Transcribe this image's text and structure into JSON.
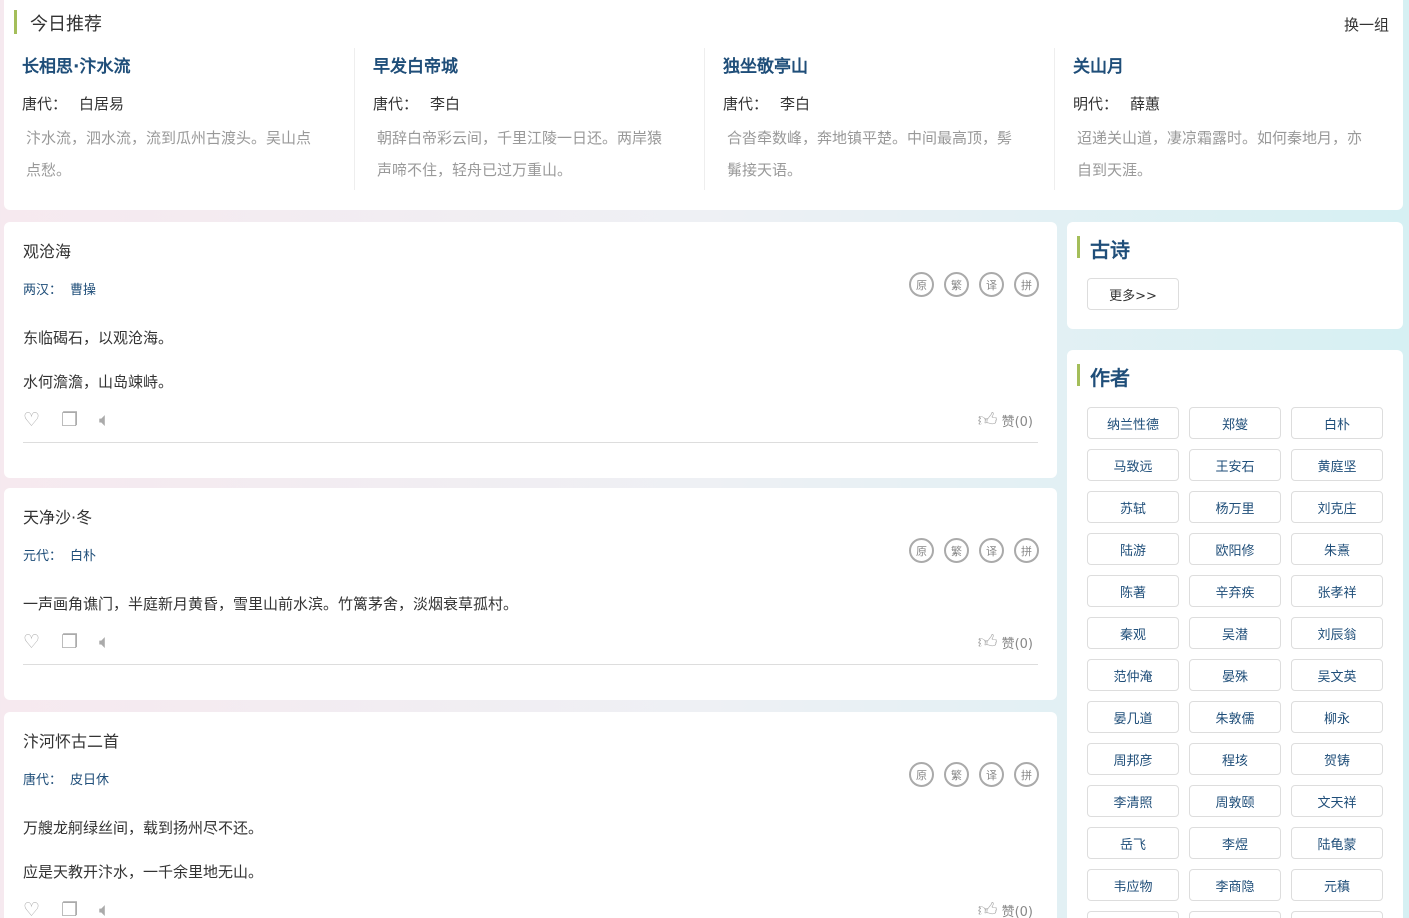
{
  "recommend": {
    "title": "今日推荐",
    "change": "换一组",
    "items": [
      {
        "title": "长相思·汴水流",
        "dynasty": "唐代：",
        "author": "白居易",
        "text": "汴水流，泗水流，流到瓜州古渡头。吴山点点愁。"
      },
      {
        "title": "早发白帝城",
        "dynasty": "唐代：",
        "author": "李白",
        "text": "朝辞白帝彩云间，千里江陵一日还。两岸猿声啼不住，轻舟已过万重山。"
      },
      {
        "title": "独坐敬亭山",
        "dynasty": "唐代：",
        "author": "李白",
        "text": "合沓牵数峰，奔地镇平楚。中间最高顶，髣髴接天语。"
      },
      {
        "title": "关山月",
        "dynasty": "明代：",
        "author": "薛蕙",
        "text": "迢递关山道，凄凉霜露时。如何秦地月，亦自到天涯。"
      }
    ]
  },
  "poems": [
    {
      "title": "观沧海",
      "dynasty": "两汉：",
      "author": "曹操",
      "lines": [
        "东临碣石，以观沧海。",
        "水何澹澹，山岛竦峙。"
      ],
      "like": "赞(0)"
    },
    {
      "title": "天净沙·冬",
      "dynasty": "元代：",
      "author": "白朴",
      "lines": [
        "一声画角谯门，半庭新月黄昏，雪里山前水滨。竹篱茅舍，淡烟衰草孤村。"
      ],
      "like": "赞(0)"
    },
    {
      "title": "汴河怀古二首",
      "dynasty": "唐代：",
      "author": "皮日休",
      "lines": [
        "万艘龙舸绿丝间，载到扬州尽不还。",
        "应是天教开汴水，一千余里地无山。"
      ],
      "like": "赞(0)"
    }
  ],
  "tools": [
    "原",
    "繁",
    "译",
    "拼"
  ],
  "sidebar": {
    "gushi": {
      "title": "古诗",
      "more": "更多>>"
    },
    "authors": {
      "title": "作者",
      "names": [
        "纳兰性德",
        "郑燮",
        "白朴",
        "马致远",
        "王安石",
        "黄庭坚",
        "苏轼",
        "杨万里",
        "刘克庄",
        "陆游",
        "欧阳修",
        "朱熹",
        "陈著",
        "辛弃疾",
        "张孝祥",
        "秦观",
        "吴潜",
        "刘辰翁",
        "范仲淹",
        "晏殊",
        "吴文英",
        "晏几道",
        "朱敦儒",
        "柳永",
        "周邦彦",
        "程垓",
        "贺铸",
        "李清照",
        "周敦颐",
        "文天祥",
        "岳飞",
        "李煜",
        "陆龟蒙",
        "韦应物",
        "李商隐",
        "元稹",
        "",
        "",
        ""
      ]
    }
  },
  "colors": {
    "accent": "#a4be5a",
    "title": "#1f4e79"
  }
}
